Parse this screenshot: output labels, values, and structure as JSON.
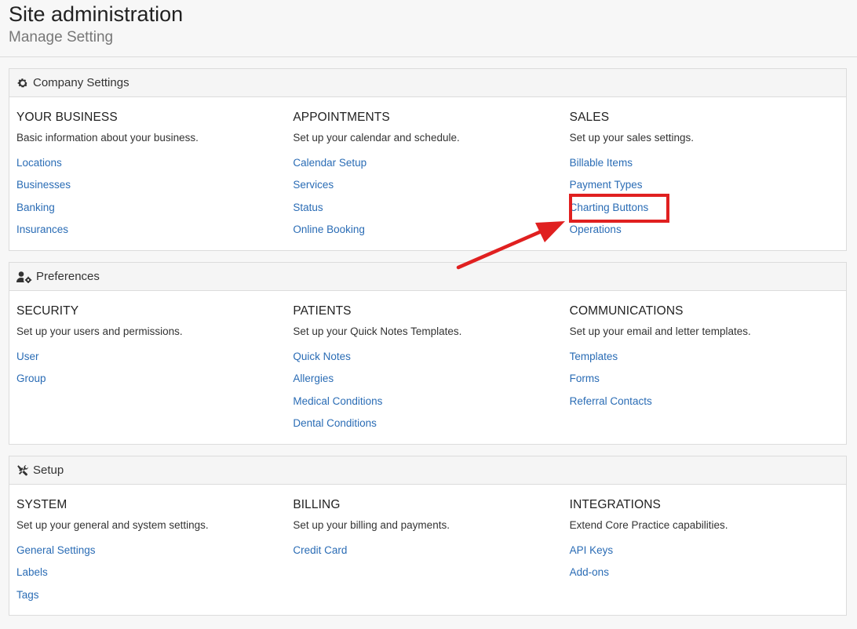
{
  "header": {
    "title": "Site administration",
    "subtitle": "Manage Setting"
  },
  "panels": [
    {
      "title": "Company Settings",
      "icon": "gear-icon",
      "columns": [
        {
          "title": "YOUR BUSINESS",
          "desc": "Basic information about your business.",
          "links": [
            "Locations",
            "Businesses",
            "Banking",
            "Insurances"
          ]
        },
        {
          "title": "APPOINTMENTS",
          "desc": "Set up your calendar and schedule.",
          "links": [
            "Calendar Setup",
            "Services",
            "Status",
            "Online Booking"
          ]
        },
        {
          "title": "SALES",
          "desc": "Set up your sales settings.",
          "links": [
            "Billable Items",
            "Payment Types",
            "Charting Buttons",
            "Operations"
          ]
        }
      ]
    },
    {
      "title": "Preferences",
      "icon": "user-gear-icon",
      "columns": [
        {
          "title": "SECURITY",
          "desc": "Set up your users and permissions.",
          "links": [
            "User",
            "Group"
          ]
        },
        {
          "title": "PATIENTS",
          "desc": "Set up your Quick Notes Templates.",
          "links": [
            "Quick Notes",
            "Allergies",
            "Medical Conditions",
            "Dental Conditions"
          ]
        },
        {
          "title": "COMMUNICATIONS",
          "desc": "Set up your email and letter templates.",
          "links": [
            "Templates",
            "Forms",
            "Referral Contacts"
          ]
        }
      ]
    },
    {
      "title": "Setup",
      "icon": "tools-icon",
      "columns": [
        {
          "title": "SYSTEM",
          "desc": "Set up your general and system settings.",
          "links": [
            "General Settings",
            "Labels",
            "Tags"
          ]
        },
        {
          "title": "BILLING",
          "desc": "Set up your billing and payments.",
          "links": [
            "Credit Card"
          ]
        },
        {
          "title": "INTEGRATIONS",
          "desc": "Extend Core Practice capabilities.",
          "links": [
            "API Keys",
            "Add-ons"
          ]
        }
      ]
    }
  ],
  "colors": {
    "link": "#2a6cb5",
    "annotation": "#e02020"
  }
}
